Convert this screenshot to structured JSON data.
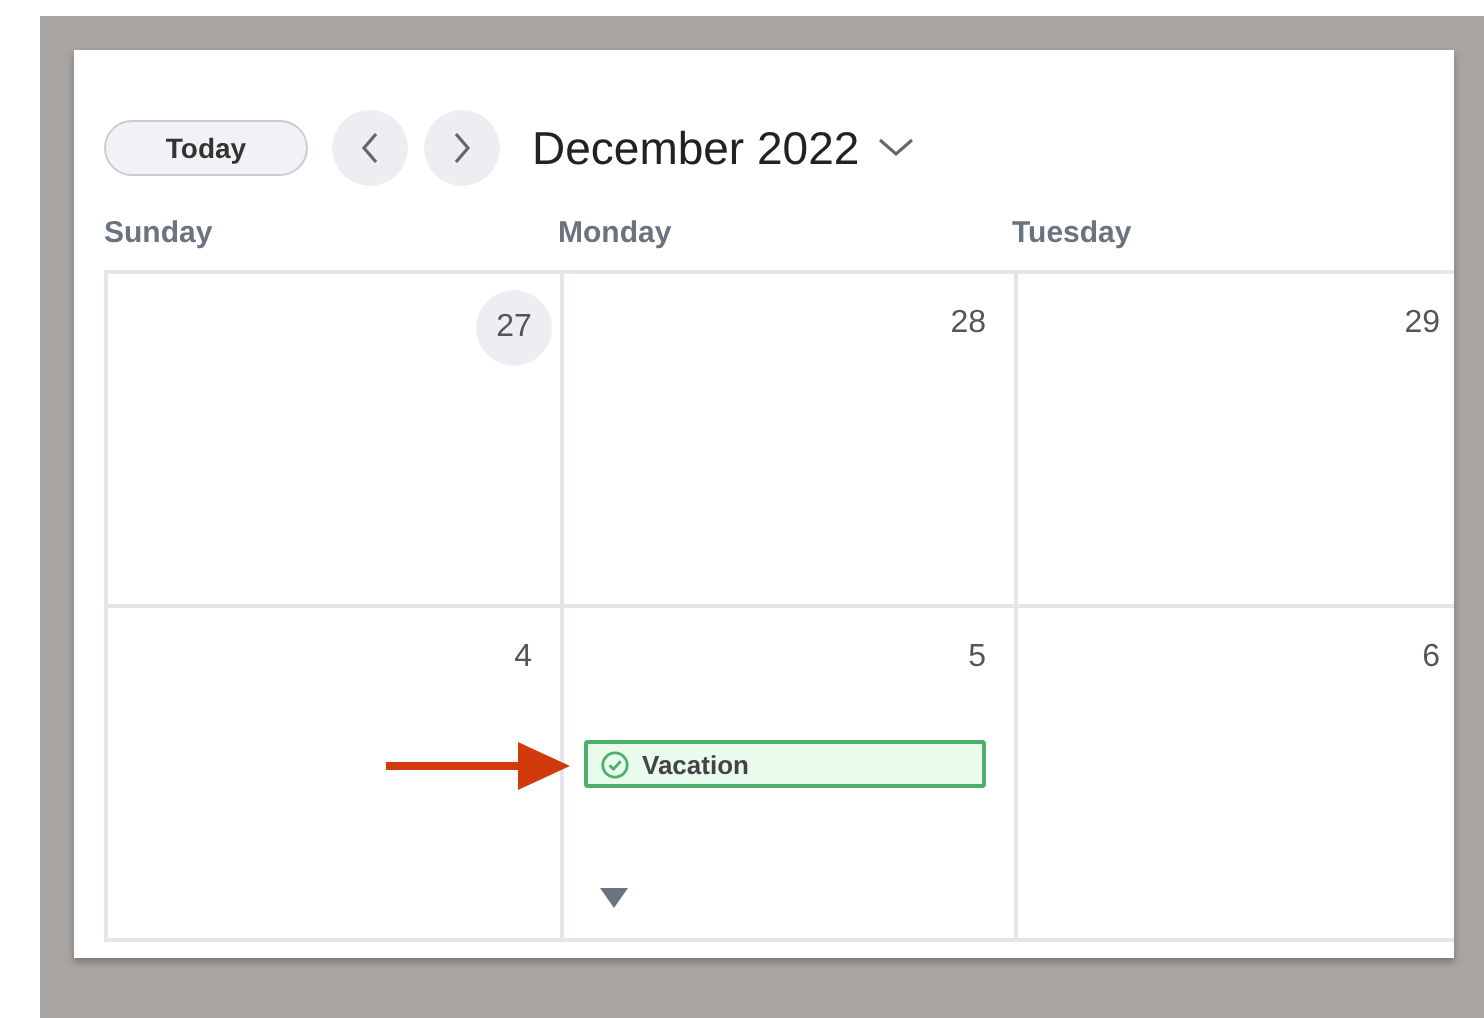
{
  "toolbar": {
    "today_button": "Today",
    "month_title": "December 2022"
  },
  "weekdays": [
    "Sunday",
    "Monday",
    "Tuesday"
  ],
  "weeks": [
    [
      {
        "day": "27",
        "highlighted": true,
        "more": false
      },
      {
        "day": "28",
        "highlighted": false,
        "more": false
      },
      {
        "day": "29",
        "highlighted": false,
        "more": false
      }
    ],
    [
      {
        "day": "4",
        "highlighted": false,
        "more": false
      },
      {
        "day": "5",
        "highlighted": false,
        "events": [
          {
            "title": "Vacation",
            "color": "#4caf6a"
          }
        ],
        "more": true
      },
      {
        "day": "6",
        "highlighted": false,
        "more": false
      }
    ]
  ],
  "annotation": {
    "kind": "arrow",
    "color": "#d03a0c"
  }
}
